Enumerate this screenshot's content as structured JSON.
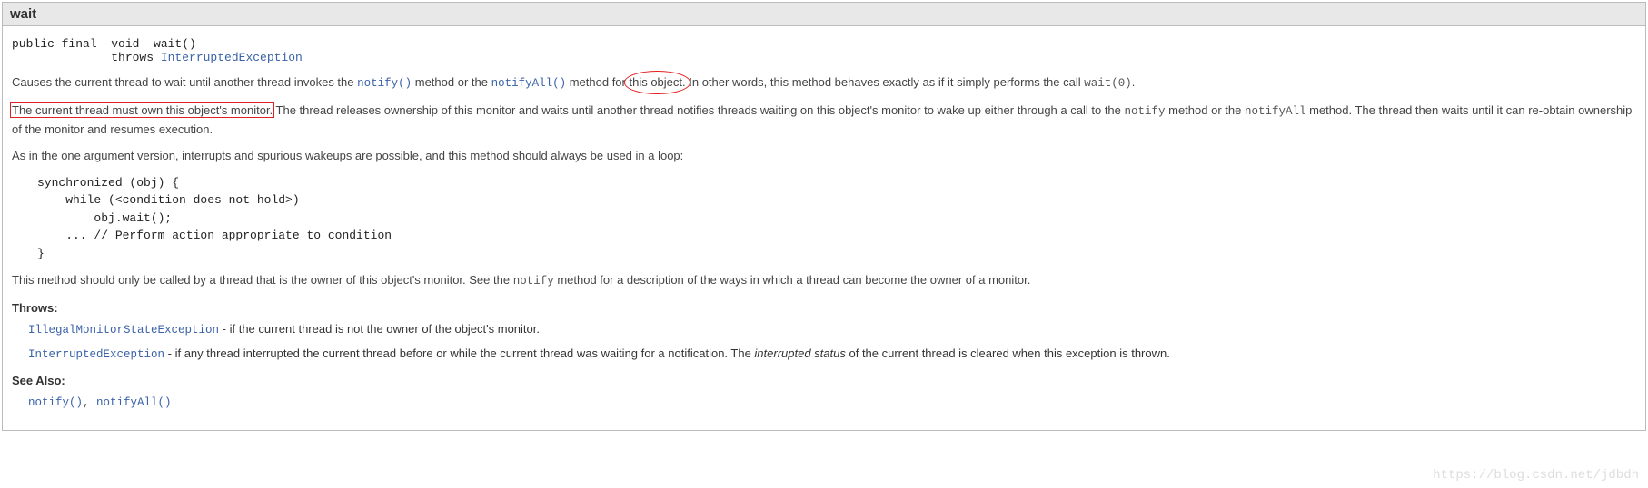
{
  "header": {
    "title": "wait"
  },
  "signature": {
    "pre": "public final  void  wait()\n              throws ",
    "exc": "InterruptedException"
  },
  "p1": {
    "a": "Causes the current thread to wait until another thread invokes the ",
    "notify": "notify()",
    "b": " method or the ",
    "notifyAll": "notifyAll()",
    "c": " method for ",
    "circled": "this object.",
    "d": " In other words, this method behaves exactly as if it simply performs the call ",
    "wait0": "wait(0)",
    "e": "."
  },
  "p2": {
    "boxed": "The current thread must own this object's monitor.",
    "a": " The thread releases ownership of this monitor and waits until another thread notifies threads waiting on this object's monitor to wake up either through a call to the ",
    "notify": "notify",
    "b": " method or the ",
    "notifyAll": "notifyAll",
    "c": " method. The thread then waits until it can re-obtain ownership of the monitor and resumes execution."
  },
  "p3": "As in the one argument version, interrupts and spurious wakeups are possible, and this method should always be used in a loop:",
  "code": "synchronized (obj) {\n    while (<condition does not hold>)\n        obj.wait();\n    ... // Perform action appropriate to condition\n}",
  "p4": {
    "a": "This method should only be called by a thread that is the owner of this object's monitor. See the ",
    "notify": "notify",
    "b": " method for a description of the ways in which a thread can become the owner of a monitor."
  },
  "throws": {
    "label": "Throws:",
    "items": [
      {
        "exc": "IllegalMonitorStateException",
        "desc": " - if the current thread is not the owner of the object's monitor."
      },
      {
        "exc": "InterruptedException",
        "desc_a": " - if any thread interrupted the current thread before or while the current thread was waiting for a notification. The ",
        "italic": "interrupted status",
        "desc_b": " of the current thread is cleared when this exception is thrown."
      }
    ]
  },
  "seealso": {
    "label": "See Also:",
    "a": "notify()",
    "sep": ", ",
    "b": "notifyAll()"
  },
  "watermark": "https://blog.csdn.net/jdbdh"
}
